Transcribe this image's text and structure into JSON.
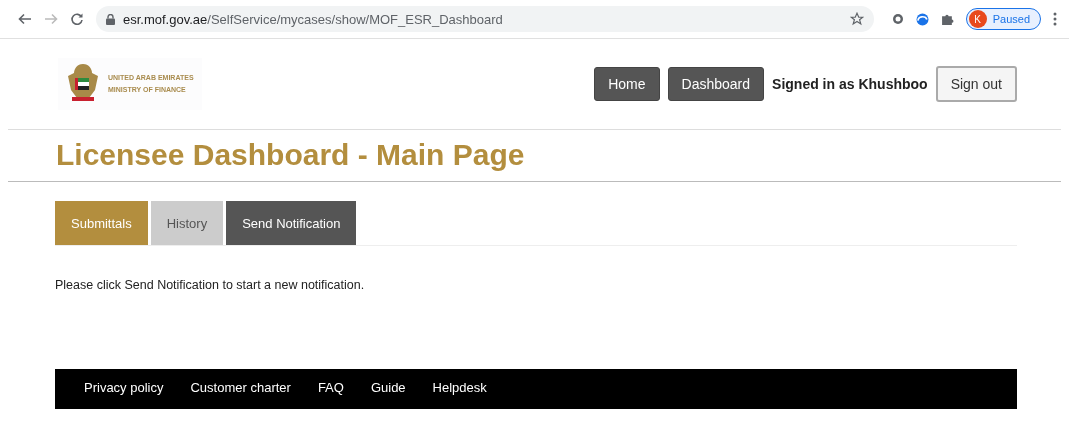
{
  "browser": {
    "url_host": "esr.mof.gov.ae",
    "url_path": "/SelfService/mycases/show/MOF_ESR_Dashboard",
    "avatar_letter": "K",
    "profile_status": "Paused"
  },
  "header": {
    "logo_lines": [
      "UNITED ARAB EMIRATES",
      "MINISTRY OF FINANCE"
    ],
    "nav": [
      {
        "label": "Home",
        "kind": "nav"
      },
      {
        "label": "Dashboard",
        "kind": "nav"
      },
      {
        "label": "Signed in as Khushboo",
        "kind": "text"
      },
      {
        "label": "Sign out",
        "kind": "outline"
      }
    ]
  },
  "page_title": "Licensee Dashboard - Main Page",
  "tabs": [
    {
      "label": "Submittals",
      "selected": true,
      "kind": "tab"
    },
    {
      "label": "History",
      "selected": false,
      "kind": "tab"
    },
    {
      "label": "Send Notification",
      "selected": false,
      "kind": "action"
    }
  ],
  "message": "Please click Send Notification to start a new notification.",
  "footer_links": [
    "Privacy policy",
    "Customer charter",
    "FAQ",
    "Guide",
    "Helpdesk"
  ]
}
